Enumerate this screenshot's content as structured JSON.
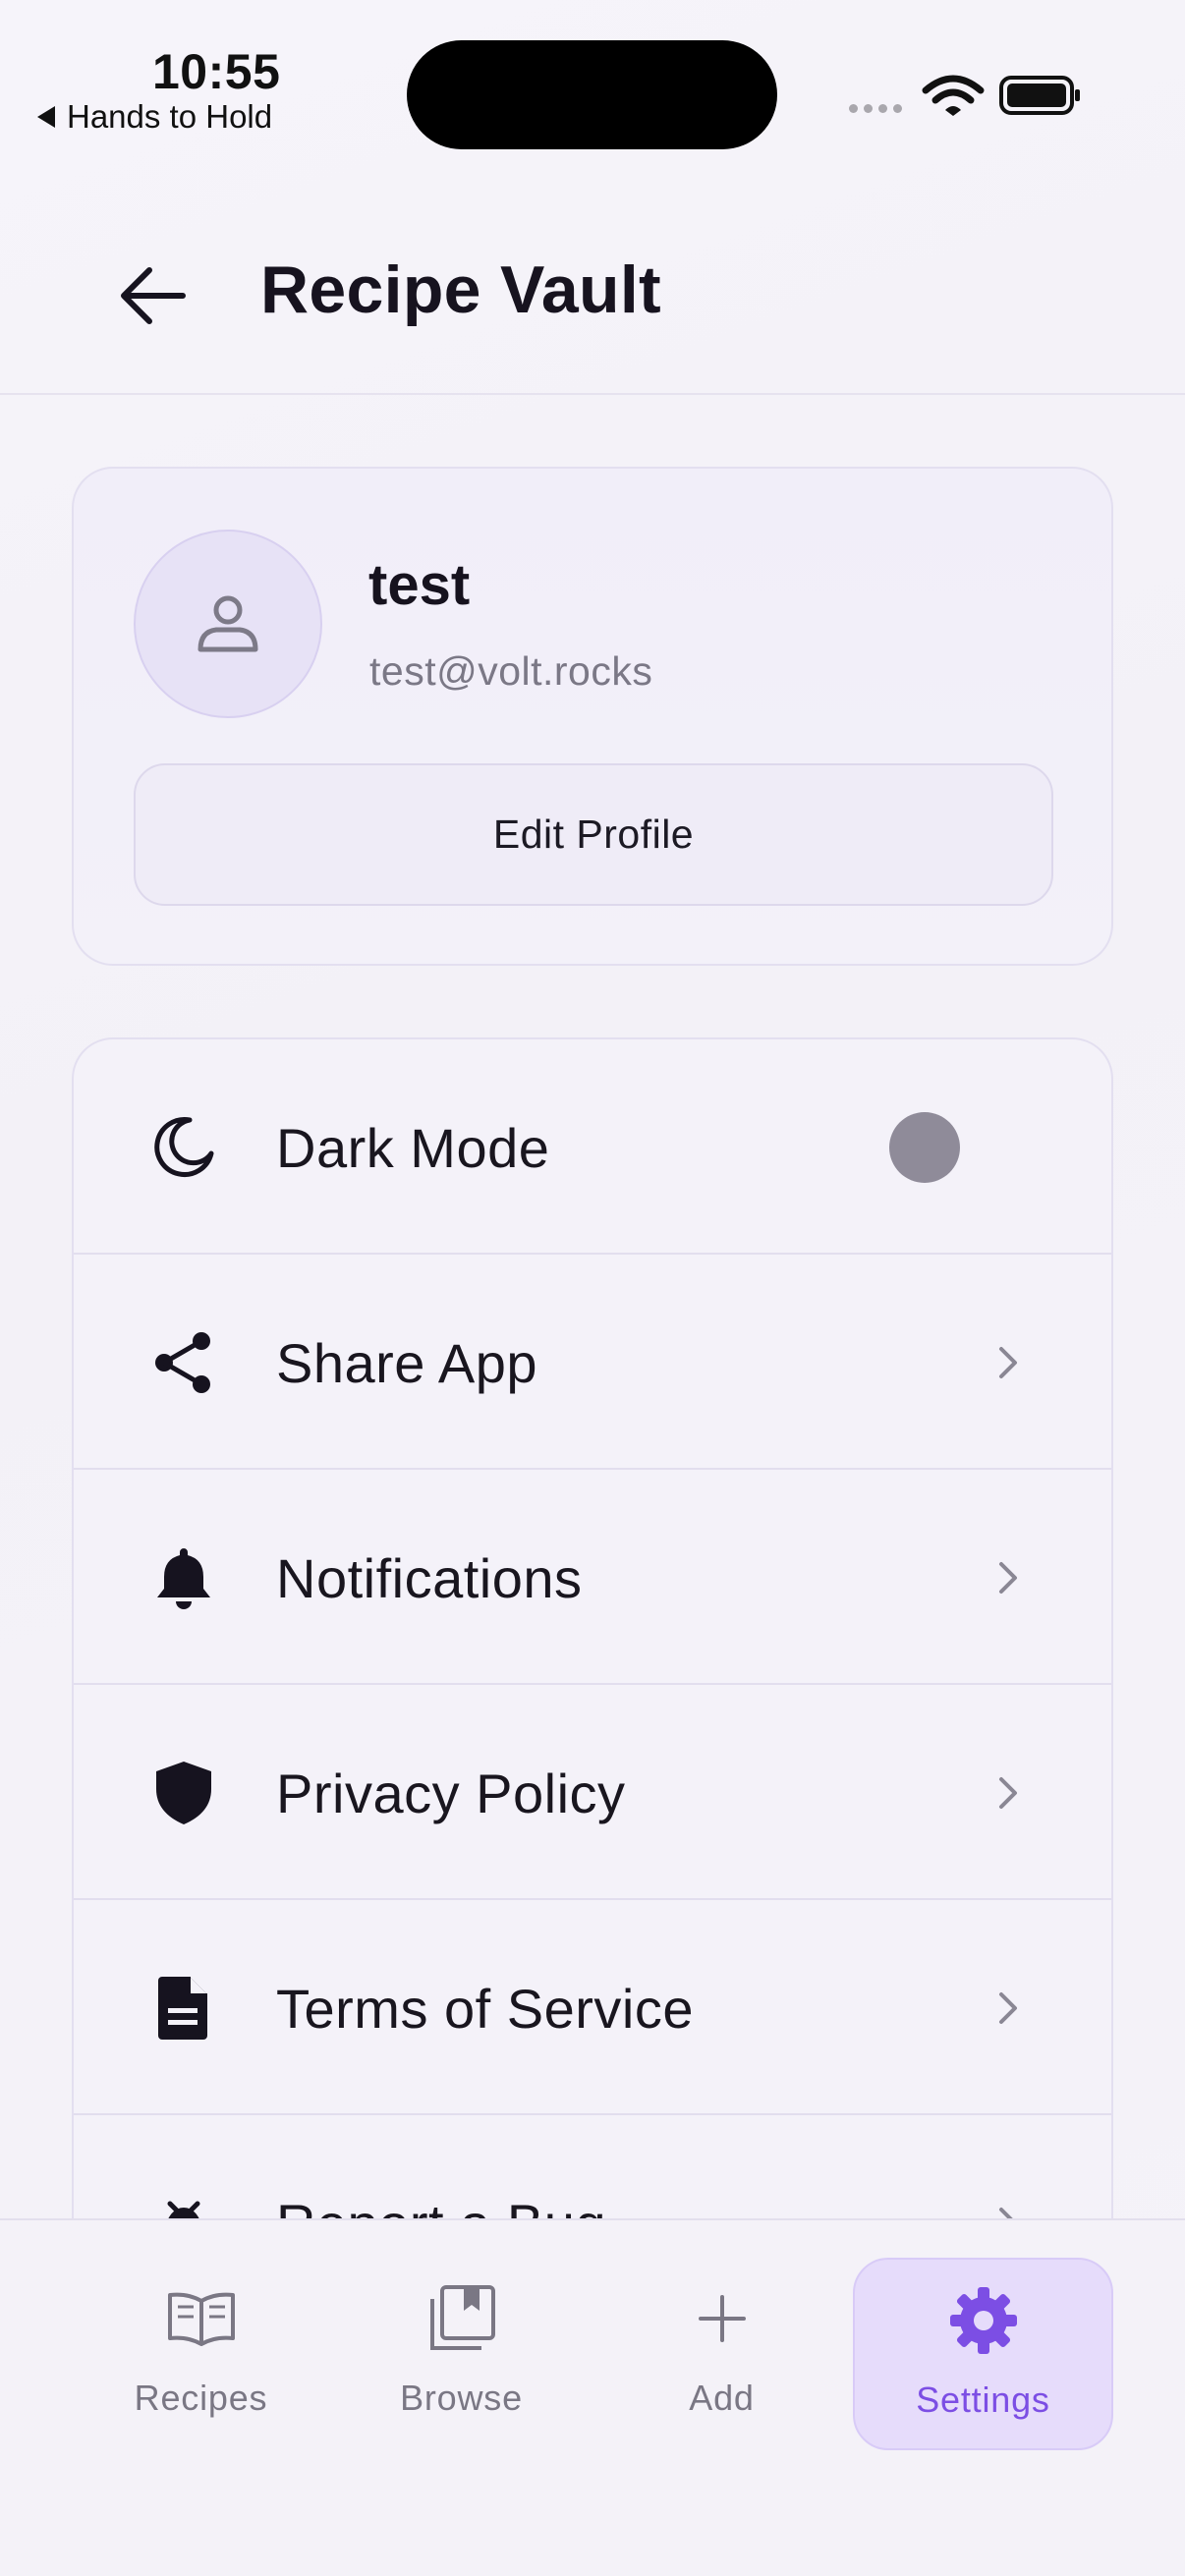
{
  "status_bar": {
    "time": "10:55",
    "back_app": "Hands to Hold"
  },
  "header": {
    "title": "Recipe Vault",
    "back_icon": "arrow-left-icon"
  },
  "profile": {
    "name": "test",
    "email": "test@volt.rocks",
    "edit_label": "Edit Profile",
    "avatar_icon": "user-icon"
  },
  "settings": {
    "dark_mode": {
      "label": "Dark Mode",
      "icon": "moon-icon",
      "enabled": false
    },
    "share_app": {
      "label": "Share App",
      "icon": "share-icon"
    },
    "notifications": {
      "label": "Notifications",
      "icon": "bell-icon"
    },
    "privacy_policy": {
      "label": "Privacy Policy",
      "icon": "shield-icon"
    },
    "terms_of_service": {
      "label": "Terms of Service",
      "icon": "document-icon"
    },
    "report_bug": {
      "label": "Report a Bug",
      "icon": "bug-icon"
    }
  },
  "bottom_nav": {
    "recipes": "Recipes",
    "browse": "Browse",
    "add": "Add",
    "settings": "Settings",
    "active": "settings"
  },
  "colors": {
    "accent": "#7c4ee4",
    "accent_bg": "#e6dcfb",
    "text_primary": "#16131f",
    "text_secondary": "#7a7784"
  }
}
